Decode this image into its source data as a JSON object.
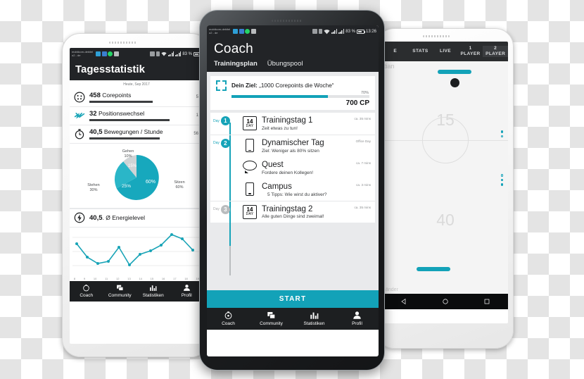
{
  "statusbar": {
    "carrier": "mobilcom-debitel\no2 - de",
    "battery": "83 %",
    "time": "13:26",
    "icons": [
      "message-icon",
      "calendar-icon",
      "whatsapp-icon",
      "mail-icon",
      "sd-card-icon",
      "vibrate-icon",
      "wifi-icon",
      "signal1-icon",
      "signal2-icon"
    ]
  },
  "center_phone": {
    "header": {
      "title": "Coach",
      "tabs": [
        {
          "label": "Trainingsplan",
          "active": true
        },
        {
          "label": "Übungspool",
          "active": false
        }
      ]
    },
    "goal_card": {
      "label_bold": "Dein Ziel:",
      "label_rest": " „1000 Corepoints die Woche“",
      "percent_text": "70%",
      "percent_value": 70,
      "total_text": "700 CP"
    },
    "plan_items": [
      {
        "day_label": "Day",
        "day_number": "1",
        "icon": "calendar-14-day-icon",
        "cal_big": "14",
        "cal_small": "DAY",
        "title": "Trainingstag 1",
        "subtitle": "Zeit etwas zu tun!",
        "meta": "ca. 35 mins"
      },
      {
        "day_label": "Day",
        "day_number": "2",
        "icon": "mobile-phone-icon",
        "title": "Dynamischer Tag",
        "subtitle": "Ziel: Weniger als 80% sitzen",
        "meta": "Office Day"
      },
      {
        "day_label": "",
        "day_number": "",
        "icon": "speech-bubble-icon",
        "title": "Quest",
        "subtitle": "Fordere deinen Kollegen!",
        "meta": "ca. 7 mins"
      },
      {
        "day_label": "",
        "day_number": "",
        "icon": "mobile-phone-icon",
        "title": "Campus",
        "subtitle": "5 Tipps: Wie wirst du aktiver?",
        "meta": "ca. 3 mins"
      },
      {
        "day_label": "Day",
        "day_number": "3",
        "icon": "calendar-14-day-icon",
        "cal_big": "14",
        "cal_small": "DAY",
        "title": "Trainingstag 2",
        "subtitle": "Alle guten Dinge sind zweimal!",
        "meta": "ca. 35 mins"
      }
    ],
    "start_button": "START",
    "tabbar": [
      {
        "label": "Coach",
        "icon": "stopwatch-icon"
      },
      {
        "label": "Community",
        "icon": "chat-windows-icon"
      },
      {
        "label": "Statistiken",
        "icon": "bar-chart-icon"
      },
      {
        "label": "Profil",
        "icon": "person-icon"
      }
    ]
  },
  "left_phone": {
    "header_title": "Tagesstatistik",
    "date_line": "Heute, Sep 2017",
    "rows": [
      {
        "icon": "corepoints-icon",
        "value": "458",
        "unit": "Corepoints",
        "bar": 62,
        "right": "5"
      },
      {
        "icon": "position-change-icon",
        "value": "32",
        "unit": "Positionswechsel",
        "bar": 78,
        "right": "1"
      },
      {
        "icon": "stopwatch-icon",
        "value": "40,5",
        "unit": "Bewegungen / Stunde",
        "bar": 70,
        "right": "56"
      }
    ],
    "energy_row": {
      "icon": "energy-bolt-icon",
      "value": "40,5",
      "unit": ". Ø Energielevel"
    },
    "chart_data": {
      "type": "pie",
      "title": "",
      "categories": [
        "Sitzen",
        "Stehen",
        "Gehen"
      ],
      "values": [
        60,
        30,
        10
      ],
      "inner_labels": [
        "60%",
        "25%",
        "15%"
      ],
      "outer_labels": [
        {
          "name": "Gehen",
          "pct": "10%"
        },
        {
          "name": "Stehen",
          "pct": "30%"
        },
        {
          "name": "Sitzen",
          "pct": "60%"
        }
      ],
      "colors": [
        "#17a8bd",
        "#2ab6c8",
        "#cfd3d5"
      ],
      "legend": "labels-around"
    },
    "line_chart": {
      "type": "line",
      "title": "",
      "xlabel": "",
      "ylabel": "",
      "x": [
        8,
        9,
        10,
        11,
        12,
        13,
        14,
        15,
        16,
        17,
        18,
        19
      ],
      "values": [
        62,
        34,
        22,
        26,
        56,
        20,
        40,
        46,
        56,
        82,
        72,
        48
      ],
      "ylim": [
        0,
        100
      ],
      "color": "#19a4b7",
      "grid": true
    },
    "tabbar": [
      {
        "label": "Coach",
        "icon": "stopwatch-icon"
      },
      {
        "label": "Community",
        "icon": "chat-windows-icon"
      },
      {
        "label": "Statistiken",
        "icon": "bar-chart-icon"
      },
      {
        "label": "Profil",
        "icon": "person-icon"
      }
    ]
  },
  "right_phone": {
    "tabs": [
      {
        "label": "E",
        "sub": "",
        "selected": false
      },
      {
        "label": "STATS",
        "sub": "",
        "selected": false
      },
      {
        "label": "LIVE",
        "sub": "",
        "selected": false
      },
      {
        "label": "1",
        "sub": "PLAYER",
        "selected": false
      },
      {
        "label": "2",
        "sub": "PLAYER",
        "selected": true
      }
    ],
    "cut_text_top": "tian",
    "score_top": "15",
    "score_bottom": "40",
    "cut_text_bottom": "änder",
    "accent": "#13a2b8",
    "navbar": [
      "back-icon",
      "home-icon",
      "recents-icon"
    ]
  }
}
